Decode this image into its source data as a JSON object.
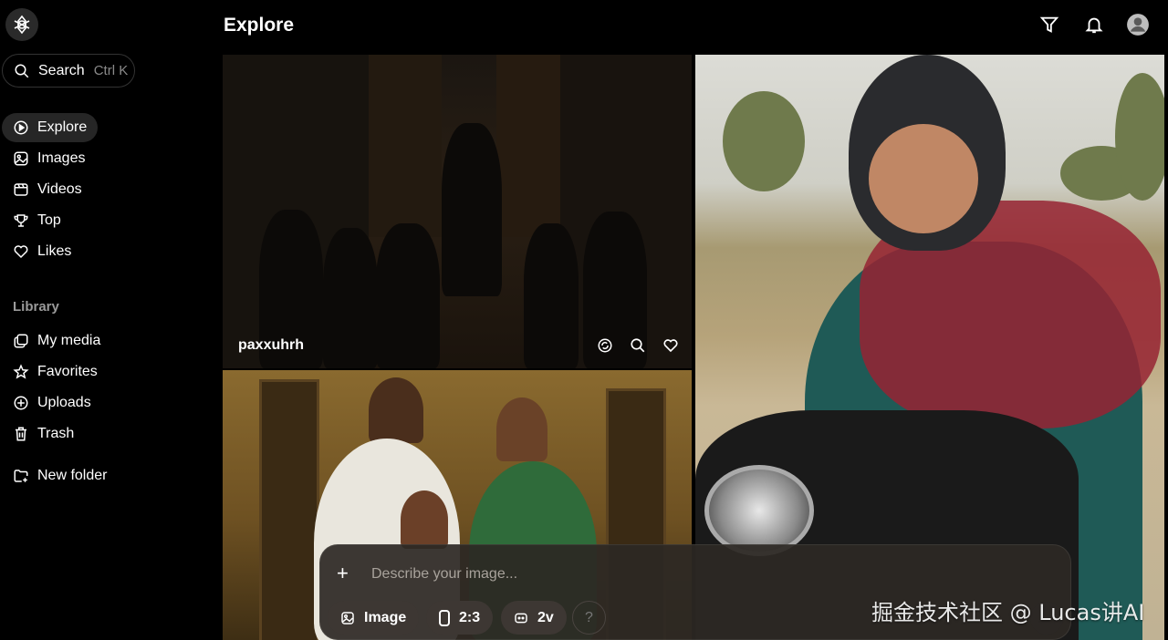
{
  "header": {
    "title": "Explore"
  },
  "sidebar": {
    "search": {
      "label": "Search",
      "shortcut": "Ctrl K"
    },
    "nav": [
      {
        "label": "Explore",
        "icon": "explore-icon",
        "active": true
      },
      {
        "label": "Images",
        "icon": "images-icon"
      },
      {
        "label": "Videos",
        "icon": "videos-icon"
      },
      {
        "label": "Top",
        "icon": "trophy-icon"
      },
      {
        "label": "Likes",
        "icon": "heart-icon"
      }
    ],
    "library_title": "Library",
    "library": [
      {
        "label": "My media",
        "icon": "my-media-icon"
      },
      {
        "label": "Favorites",
        "icon": "star-icon"
      },
      {
        "label": "Uploads",
        "icon": "upload-icon"
      },
      {
        "label": "Trash",
        "icon": "trash-icon"
      }
    ],
    "new_folder": {
      "label": "New folder",
      "icon": "new-folder-icon"
    }
  },
  "feed": {
    "tiles": [
      {
        "username": "paxxuhrh"
      }
    ]
  },
  "prompt": {
    "placeholder": "Describe your image...",
    "mode_label": "Image",
    "aspect_label": "2:3",
    "variants_label": "2v",
    "help_label": "?"
  },
  "watermark": "掘金技术社区 @ Lucas讲AI",
  "colors": {
    "background": "#000000",
    "active_nav": "#262626",
    "prompt_bg": "#2d2824"
  }
}
